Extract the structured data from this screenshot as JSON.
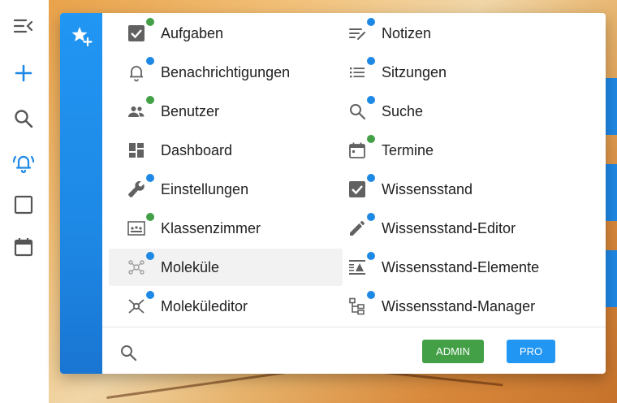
{
  "rail": {
    "icons": [
      "menu-collapse-icon",
      "add-icon",
      "search-icon",
      "bell-ring-icon",
      "square-icon",
      "calendar-icon"
    ]
  },
  "popup": {
    "left_column": [
      {
        "label": "Aufgaben",
        "icon": "checkbox-icon",
        "dot": "green"
      },
      {
        "label": "Benachrichtigungen",
        "icon": "bell-icon",
        "dot": "blue"
      },
      {
        "label": "Benutzer",
        "icon": "users-icon",
        "dot": "green"
      },
      {
        "label": "Dashboard",
        "icon": "dashboard-icon",
        "dot": "none"
      },
      {
        "label": "Einstellungen",
        "icon": "wrench-icon",
        "dot": "blue"
      },
      {
        "label": "Klassenzimmer",
        "icon": "classroom-icon",
        "dot": "green"
      },
      {
        "label": "Moleküle",
        "icon": "molecule-icon",
        "dot": "blue"
      },
      {
        "label": "Moleküleditor",
        "icon": "molecule-editor-icon",
        "dot": "blue"
      }
    ],
    "right_column": [
      {
        "label": "Notizen",
        "icon": "notes-icon",
        "dot": "blue"
      },
      {
        "label": "Sitzungen",
        "icon": "list-icon",
        "dot": "blue"
      },
      {
        "label": "Suche",
        "icon": "search-icon",
        "dot": "blue"
      },
      {
        "label": "Termine",
        "icon": "calendar-icon",
        "dot": "green"
      },
      {
        "label": "Wissensstand",
        "icon": "checkbox-icon",
        "dot": "blue"
      },
      {
        "label": "Wissensstand-Editor",
        "icon": "pencil-icon",
        "dot": "blue"
      },
      {
        "label": "Wissensstand-Elemente",
        "icon": "elements-icon",
        "dot": "blue"
      },
      {
        "label": "Wissensstand-Manager",
        "icon": "sitemap-icon",
        "dot": "blue"
      }
    ],
    "highlighted_item": "Moleküle",
    "footer": {
      "admin_label": "ADMIN",
      "pro_label": "PRO"
    }
  },
  "colors": {
    "accent_blue": "#1e88e5",
    "dot_green": "#43a047",
    "dot_blue": "#1e88e5",
    "admin_button": "#43a047",
    "pro_button": "#2196f3",
    "icon_grey": "#616161"
  }
}
